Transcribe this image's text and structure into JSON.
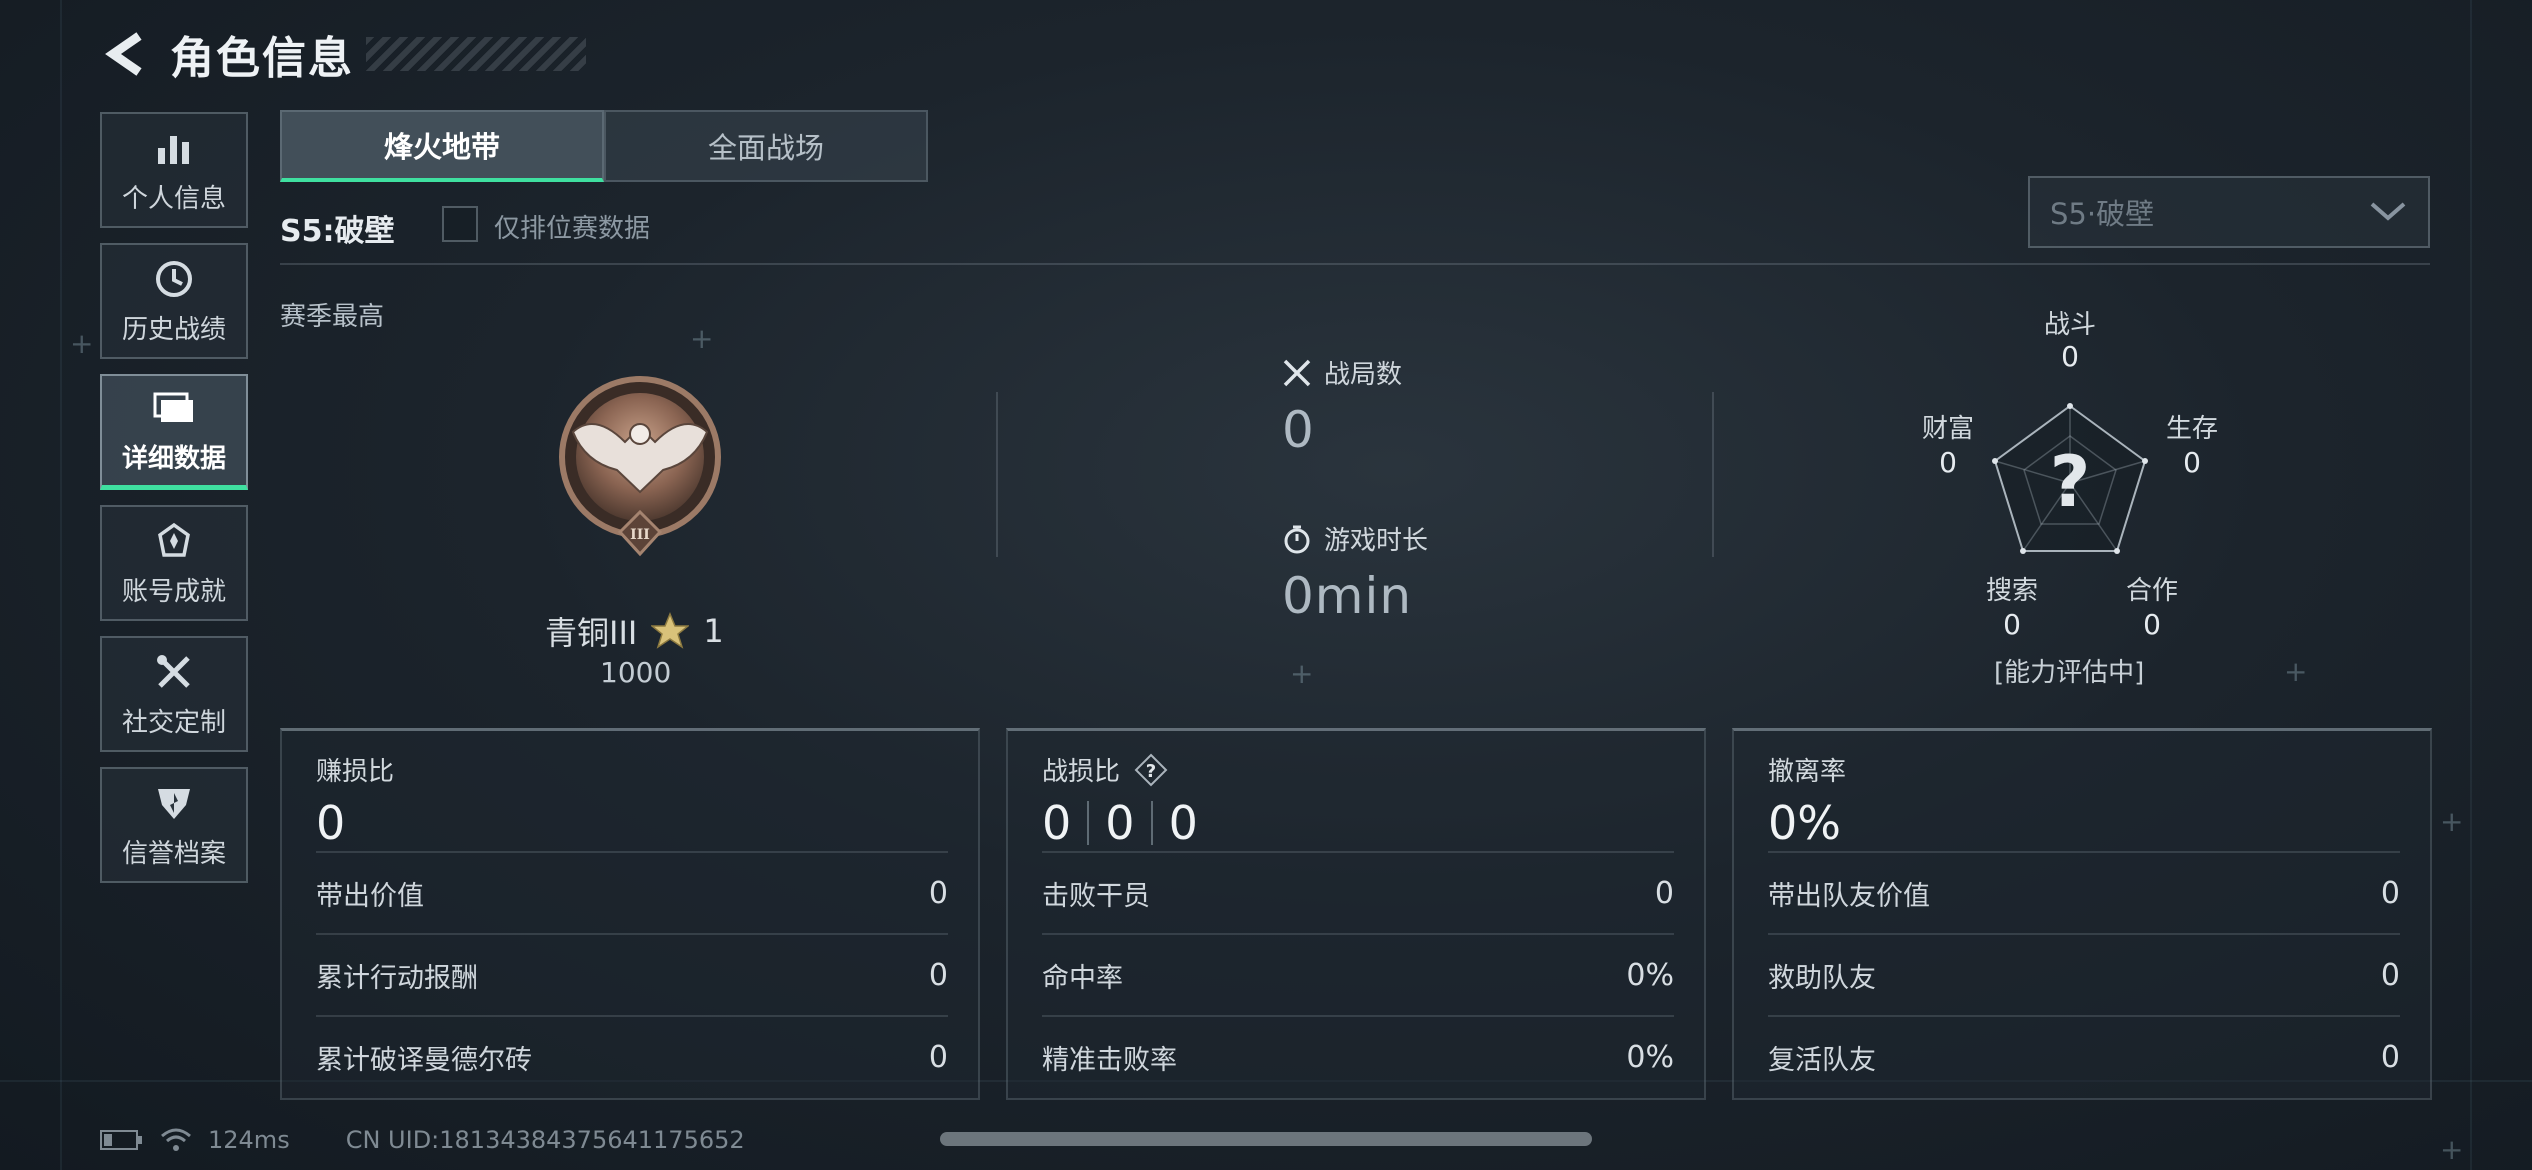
{
  "header": {
    "title": "角色信息"
  },
  "sidebar": {
    "items": [
      {
        "label": "个人信息",
        "icon": "bar-chart-icon"
      },
      {
        "label": "历史战绩",
        "icon": "clock-icon"
      },
      {
        "label": "详细数据",
        "icon": "folder-icon",
        "active": true
      },
      {
        "label": "账号成就",
        "icon": "badge-icon"
      },
      {
        "label": "社交定制",
        "icon": "tools-icon"
      },
      {
        "label": "信誉档案",
        "icon": "shield-icon"
      }
    ]
  },
  "tabs": [
    {
      "label": "烽火地带",
      "active": true
    },
    {
      "label": "全面战场",
      "active": false
    }
  ],
  "season": {
    "label": "S5:破壁",
    "ranked_only_label": "仅排位赛数据",
    "ranked_only_checked": false,
    "select_value": "S5·破壁"
  },
  "season_best": {
    "title": "赛季最高",
    "rank_name": "青铜III",
    "stars": "1",
    "score": "1000",
    "badge_numeral": "III"
  },
  "stats": {
    "matches_label": "战局数",
    "matches_value": "0",
    "playtime_label": "游戏时长",
    "playtime_value": "0min"
  },
  "radar": {
    "combat_label": "战斗",
    "combat_value": "0",
    "survival_label": "生存",
    "survival_value": "0",
    "teamwork_label": "合作",
    "teamwork_value": "0",
    "search_label": "搜索",
    "search_value": "0",
    "wealth_label": "财富",
    "wealth_value": "0",
    "center_mark": "?",
    "status": "[能力评估中]"
  },
  "panels": {
    "profit": {
      "title": "赚损比",
      "value": "0",
      "rows": [
        {
          "k": "带出价值",
          "v": "0"
        },
        {
          "k": "累计行动报酬",
          "v": "0"
        },
        {
          "k": "累计破译曼德尔砖",
          "v": "0"
        }
      ]
    },
    "kd": {
      "title": "战损比",
      "values": [
        "0",
        "0",
        "0"
      ],
      "rows": [
        {
          "k": "击败干员",
          "v": "0"
        },
        {
          "k": "命中率",
          "v": "0%"
        },
        {
          "k": "精准击败率",
          "v": "0%"
        }
      ]
    },
    "extract": {
      "title": "撤离率",
      "value": "0%",
      "rows": [
        {
          "k": "带出队友价值",
          "v": "0"
        },
        {
          "k": "救助队友",
          "v": "0"
        },
        {
          "k": "复活队友",
          "v": "0"
        }
      ]
    }
  },
  "statusbar": {
    "ping": "124ms",
    "uid": "CN UID:18134384375641175652"
  },
  "colors": {
    "accent": "#3fe0a0",
    "bg": "#1c242c"
  }
}
